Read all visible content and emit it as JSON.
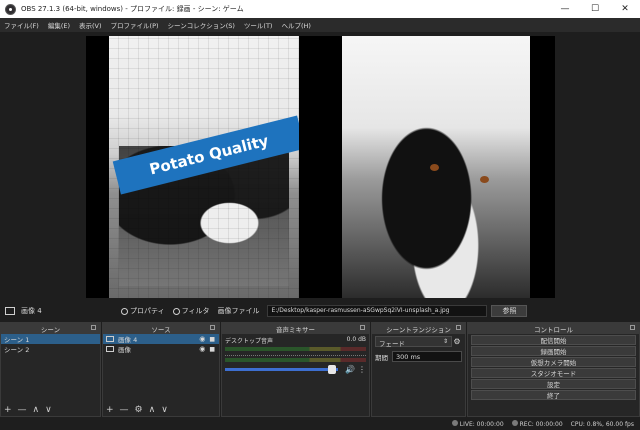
{
  "window": {
    "title": "OBS 27.1.3 (64-bit, windows) - プロファイル: 録画 - シーン: ゲーム",
    "minimize": "—",
    "maximize": "☐",
    "close": "✕"
  },
  "menu": [
    "ファイル(F)",
    "編集(E)",
    "表示(V)",
    "プロファイル(P)",
    "シーンコレクション(S)",
    "ツール(T)",
    "ヘルプ(H)"
  ],
  "preview": {
    "overlay_text": "Potato Quality"
  },
  "source_toolbar": {
    "source_name": "画像 4",
    "properties": "プロパティ",
    "filters": "フィルタ",
    "image_file_label": "画像ファイル",
    "path": "E:/Desktop/kasper-rasmussen-aSGwpSq2iVI-unsplash_a.jpg",
    "browse": "参照"
  },
  "scenes": {
    "header": "シーン",
    "items": [
      "シーン 1",
      "シーン 2"
    ]
  },
  "sources": {
    "header": "ソース",
    "items": [
      "画像 4",
      "画像"
    ]
  },
  "mixer": {
    "header": "音声ミキサー",
    "channel": "デスクトップ音声",
    "level": "0.0 dB",
    "volume_fraction": 0.95
  },
  "transitions": {
    "header": "シーントランジション",
    "selected": "フェード",
    "duration_label": "期間",
    "duration": "300 ms"
  },
  "controls": {
    "header": "コントロール",
    "buttons": [
      "配信開始",
      "録画開始",
      "仮想カメラ開始",
      "スタジオモード",
      "設定",
      "終了"
    ]
  },
  "dock_footer": {
    "add": "+",
    "remove": "—",
    "up": "∧",
    "down": "∨",
    "gear": "⚙"
  },
  "status": {
    "live": "LIVE: 00:00:00",
    "rec": "REC: 00:00:00",
    "cpu": "CPU: 0.8%, 60.00 fps"
  }
}
